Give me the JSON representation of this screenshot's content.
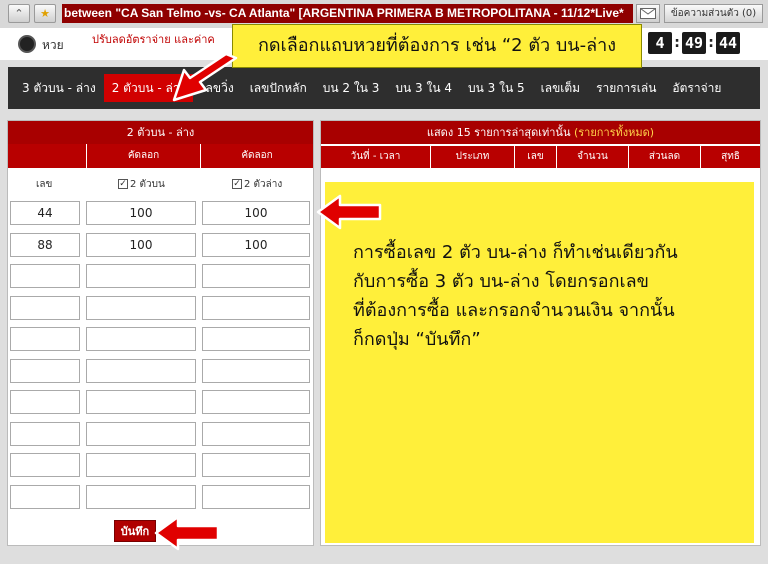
{
  "topbar": {
    "marquee": "between \"CA San Telmo -vs- CA Atlanta\" [ARGENTINA PRIMERA B METROPOLITANA - 11/12*Live*",
    "messages_label": "ข้อความส่วนตัว (0)"
  },
  "header": {
    "lotto_label": "หวย",
    "adjust_label": "ปรับลดอัตราจ่าย และค่าค",
    "clock": [
      "4",
      "49",
      "44"
    ]
  },
  "nav": {
    "items": [
      "3 ตัวบน - ล่าง",
      "2 ตัวบน - ล่าง",
      "เลขวิ่ง",
      "เลขปักหลัก",
      "บน 2 ใน 3",
      "บน 3 ใน 4",
      "บน 3 ใน 5",
      "เลขเต็ม",
      "รายการเล่น",
      "อัตราจ่าย"
    ],
    "active_index": 1
  },
  "callout_top": "กดเลือกแถบหวยที่ต้องการ เช่น “2 ตัว บน-ล่าง",
  "left_panel": {
    "title": "2 ตัวบน - ล่าง",
    "col_discount_1": "คัดลอก",
    "col_discount_2": "คัดลอก",
    "number_label": "เลข",
    "check_top": "2 ตัวบน",
    "check_bottom": "2 ตัวล่าง",
    "rows": [
      {
        "number": "44",
        "top": "100",
        "bottom": "100"
      },
      {
        "number": "88",
        "top": "100",
        "bottom": "100"
      },
      {
        "number": "",
        "top": "",
        "bottom": ""
      },
      {
        "number": "",
        "top": "",
        "bottom": ""
      },
      {
        "number": "",
        "top": "",
        "bottom": ""
      },
      {
        "number": "",
        "top": "",
        "bottom": ""
      },
      {
        "number": "",
        "top": "",
        "bottom": ""
      },
      {
        "number": "",
        "top": "",
        "bottom": ""
      },
      {
        "number": "",
        "top": "",
        "bottom": ""
      },
      {
        "number": "",
        "top": "",
        "bottom": ""
      }
    ],
    "save_label": "บันทึก"
  },
  "right_panel": {
    "title": "แสดง 15 รายการล่าสุดเท่านั้น",
    "title_link": "(รายการทั้งหมด)",
    "columns": [
      "วันที่ - เวลา",
      "ประเภท",
      "เลข",
      "จำนวน",
      "ส่วนลด",
      "สุทธิ"
    ]
  },
  "note_lines": [
    "การซื้อเลข 2 ตัว บน-ล่าง ก็ทำเช่นเดียวกัน",
    "กับการซื้อ 3 ตัว บน-ล่าง โดยกรอกเลข",
    "ที่ต้องการซื้อ และกรอกจำนวนเงิน จากนั้น",
    "ก็กดปุ่ม “บันทึก”"
  ],
  "colors": {
    "accent": "#b80000",
    "highlight": "#ffef3a",
    "nav_bg": "#2e2e2e"
  }
}
